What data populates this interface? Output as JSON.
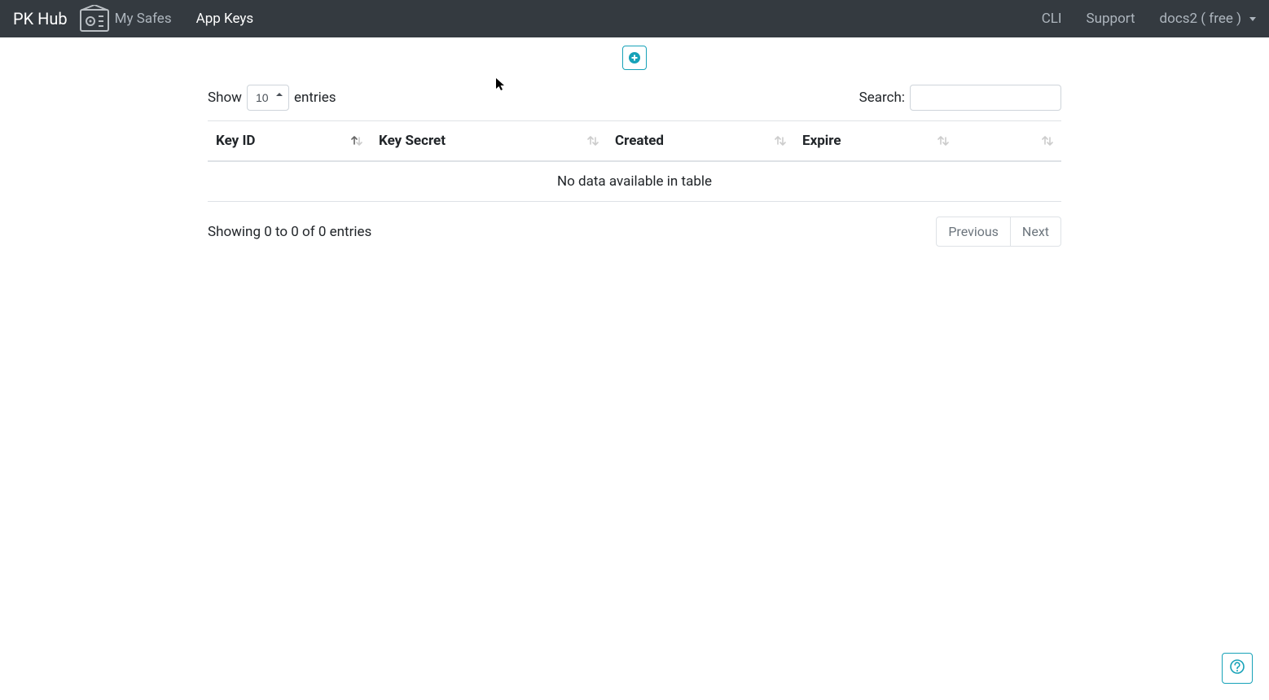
{
  "nav": {
    "brand": "PK Hub",
    "left": [
      {
        "label": "My Safes",
        "active": false
      },
      {
        "label": "App Keys",
        "active": true
      }
    ],
    "right": [
      {
        "label": "CLI"
      },
      {
        "label": "Support"
      }
    ],
    "user": "docs2 ( free )"
  },
  "dt": {
    "length_prefix": "Show",
    "length_value": "10",
    "length_suffix": "entries",
    "search_label": "Search:",
    "search_value": "",
    "columns": [
      "Key ID",
      "Key Secret",
      "Created",
      "Expire",
      ""
    ],
    "empty": "No data available in table",
    "info": "Showing 0 to 0 of 0 entries",
    "prev": "Previous",
    "next": "Next"
  },
  "colors": {
    "accent": "#17a2b8",
    "navbar_bg": "#343a40"
  }
}
